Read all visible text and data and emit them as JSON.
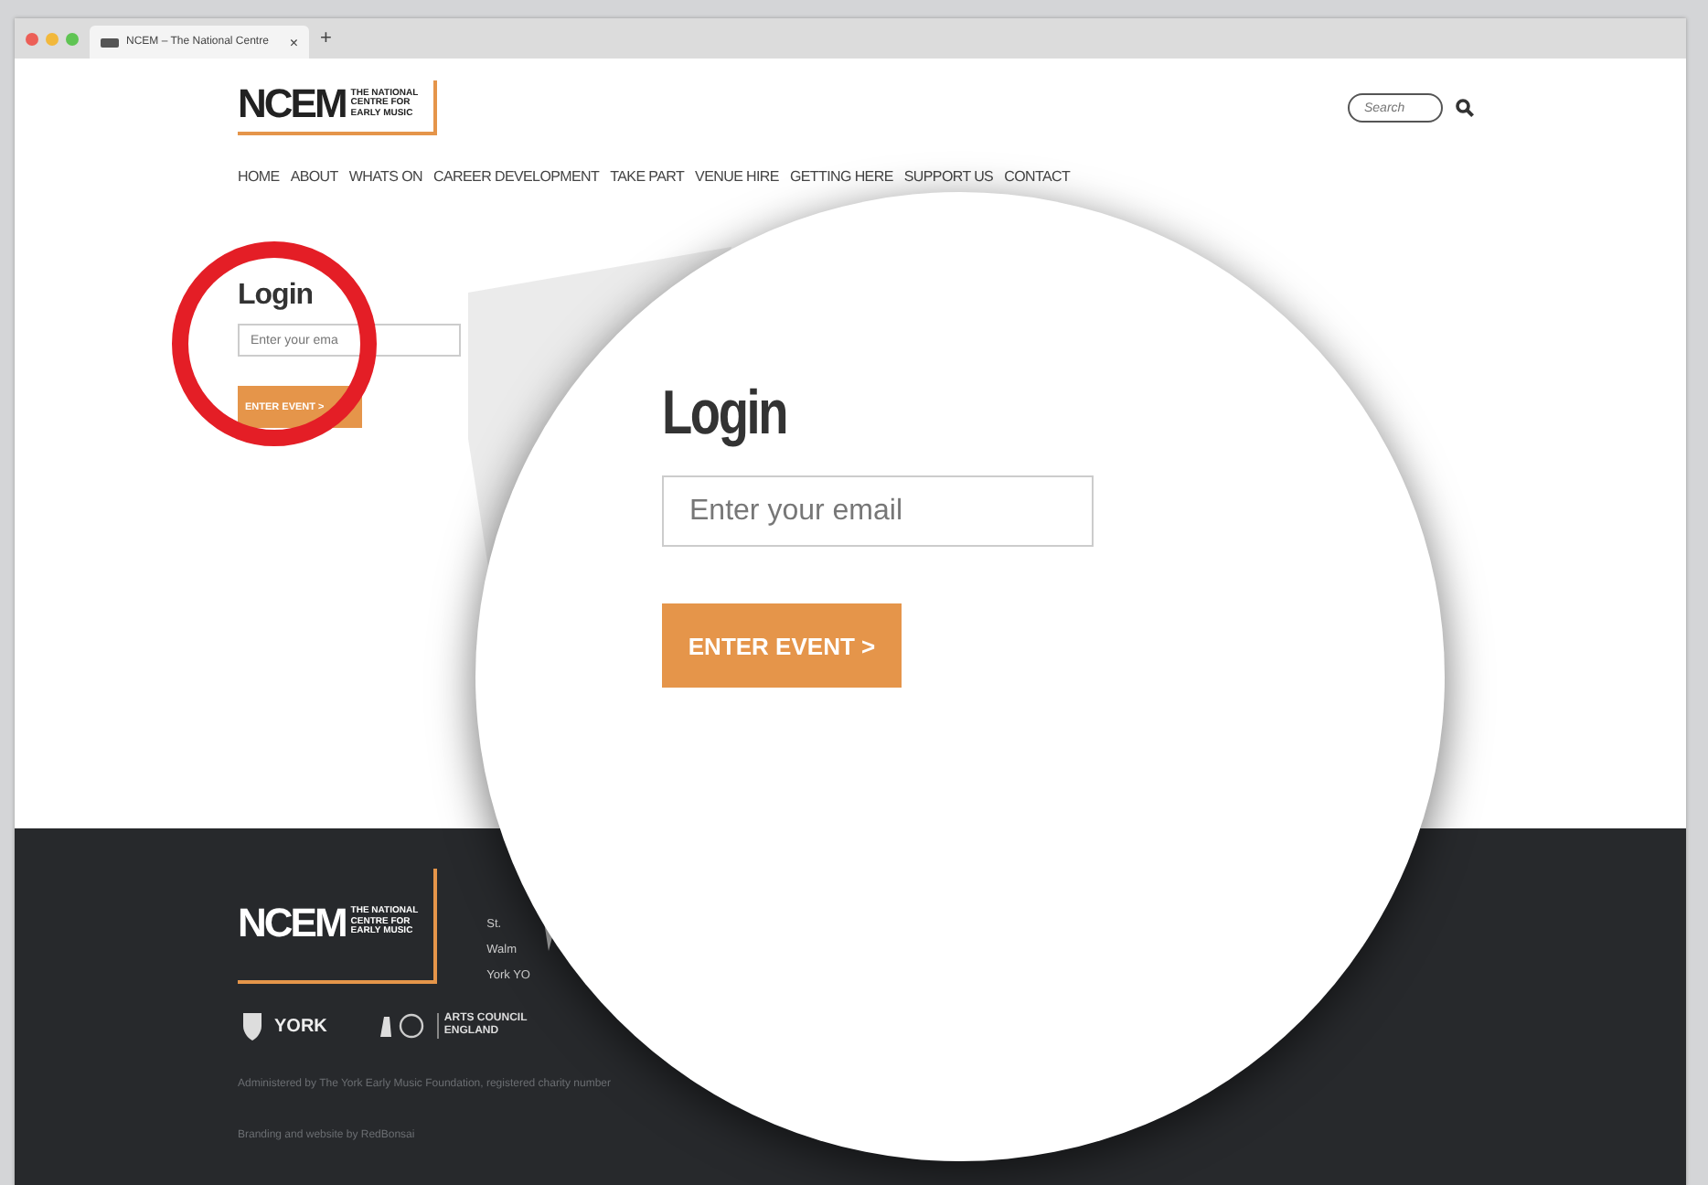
{
  "browser": {
    "tab_title": "NCEM – The National Centre",
    "tab_close": "×",
    "new_tab": "+"
  },
  "header": {
    "logo": {
      "mark": "NCEM",
      "tagline": [
        "THE NATIONAL",
        "CENTRE FOR",
        "EARLY MUSIC"
      ]
    },
    "search": {
      "placeholder": "Search"
    }
  },
  "nav": [
    "HOME",
    "ABOUT",
    "WHATS ON",
    "CAREER DEVELOPMENT",
    "TAKE PART",
    "VENUE HIRE",
    "GETTING HERE",
    "SUPPORT US",
    "CONTACT"
  ],
  "login": {
    "heading": "Login",
    "email": {
      "placeholder": "Enter your ema"
    },
    "button": "ENTER EVENT >"
  },
  "magnifier": {
    "heading": "Login",
    "email": {
      "placeholder": "Enter your email"
    },
    "button": "ENTER EVENT >"
  },
  "footer": {
    "logo": {
      "mark": "NCEM",
      "tagline": [
        "THE NATIONAL",
        "CENTRE FOR",
        "EARLY MUSIC"
      ]
    },
    "address": [
      "St.",
      "Walm",
      "York YO"
    ],
    "partners": [
      "YORK",
      "ARTS COUNCIL",
      "ENGLAND"
    ],
    "admin_note": "Administered by The York Early Music Foundation, registered charity number",
    "credit": "Branding and website by RedBonsai"
  }
}
